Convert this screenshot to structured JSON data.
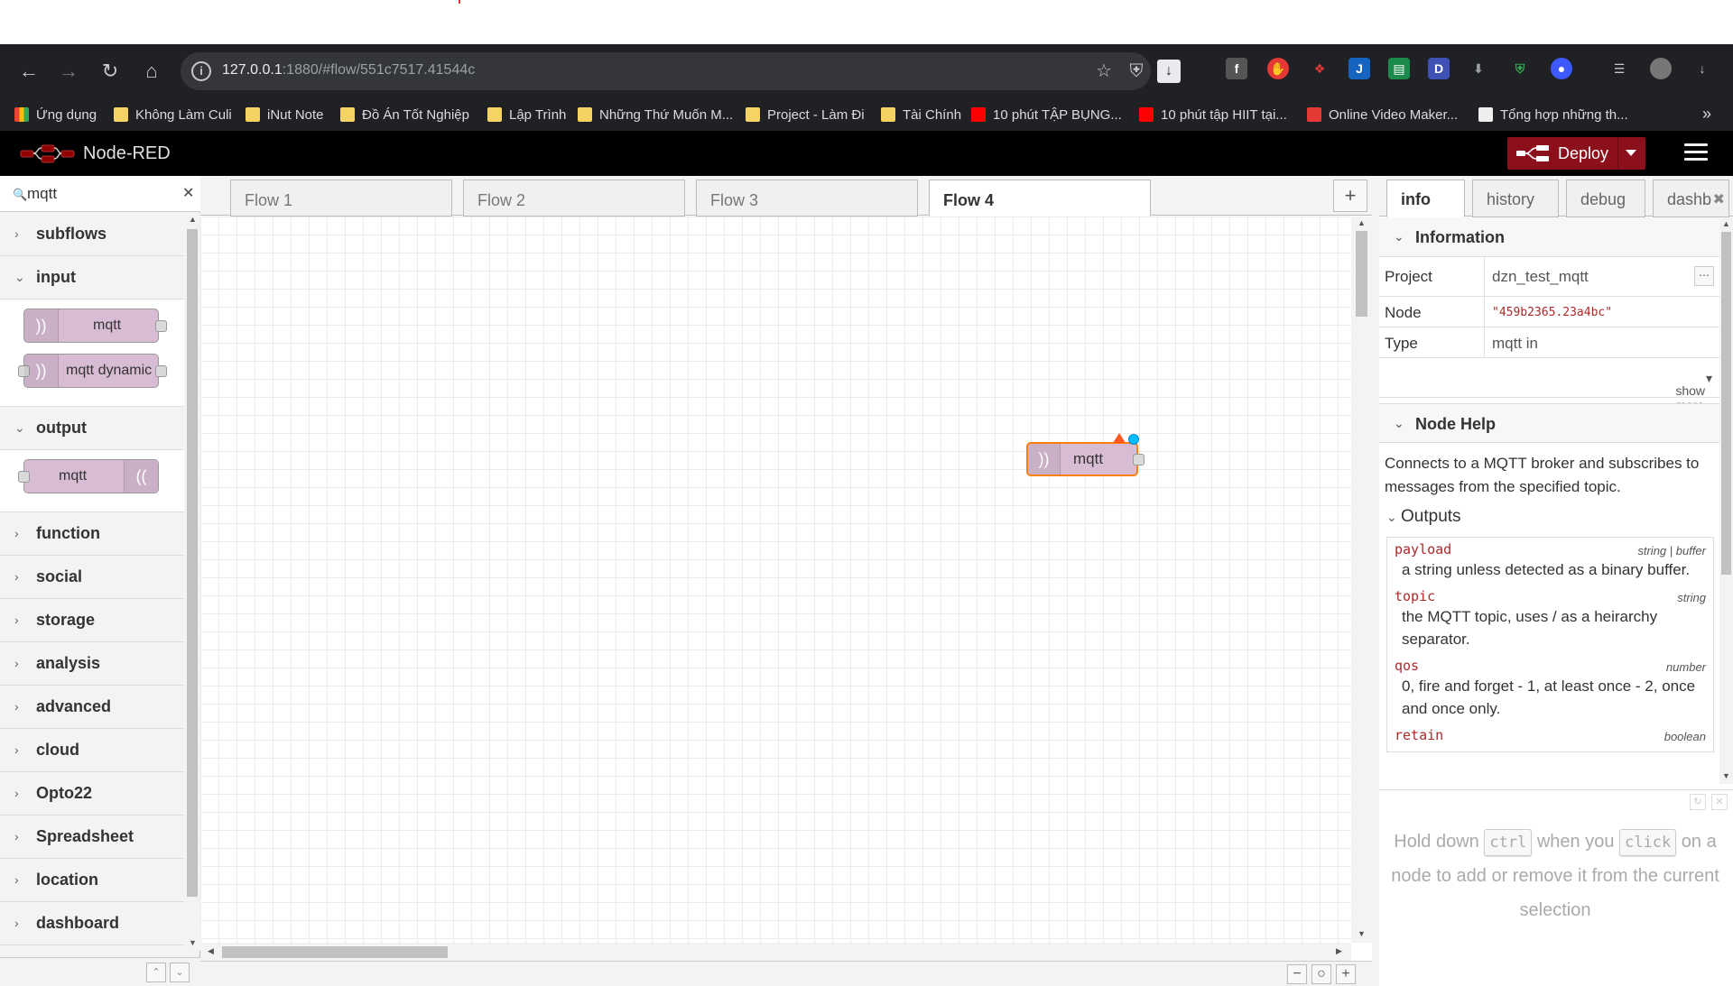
{
  "browser": {
    "url_host": "127.0.0.1",
    "url_rest": ":1880/#flow/551c7517.41544c",
    "bookmarks": [
      {
        "label": "Ứng dụng",
        "icon": "apps-icon"
      },
      {
        "label": "Không Làm Culi",
        "icon": "folder-icon"
      },
      {
        "label": "iNut Note",
        "icon": "folder-icon"
      },
      {
        "label": "Đồ Án Tốt Nghiệp",
        "icon": "folder-icon"
      },
      {
        "label": "Lập Trình",
        "icon": "folder-icon"
      },
      {
        "label": "Những Thứ Muốn M...",
        "icon": "folder-icon"
      },
      {
        "label": "Project - Làm Đi",
        "icon": "folder-icon"
      },
      {
        "label": "Tài Chính",
        "icon": "folder-icon"
      },
      {
        "label": "10 phút TẬP BỤNG...",
        "icon": "youtube-icon"
      },
      {
        "label": "10 phút tập HIIT tại...",
        "icon": "youtube-icon"
      },
      {
        "label": "Online Video Maker...",
        "icon": "gear-icon"
      },
      {
        "label": "Tổng hợp những th...",
        "icon": "ck-icon"
      }
    ],
    "more": "»"
  },
  "header": {
    "title": "Node-RED",
    "deploy_label": "Deploy"
  },
  "palette": {
    "search_value": "mqtt",
    "categories": {
      "subflows": "subflows",
      "input": "input",
      "output": "output",
      "function": "function",
      "social": "social",
      "storage": "storage",
      "analysis": "analysis",
      "advanced": "advanced",
      "cloud": "cloud",
      "opto22": "Opto22",
      "spreadsheet": "Spreadsheet",
      "location": "location",
      "dashboard": "dashboard"
    },
    "nodes": {
      "mqtt_in": "mqtt",
      "mqtt_dynamic": "mqtt dynamic",
      "mqtt_out": "mqtt"
    }
  },
  "workspace": {
    "tabs": [
      "Flow 1",
      "Flow 2",
      "Flow 3",
      "Flow 4"
    ],
    "active_tab": "Flow 4",
    "add_tab": "+",
    "node_label": "mqtt"
  },
  "sidebar": {
    "tabs": {
      "info": "info",
      "history": "history",
      "debug": "debug",
      "dashboard": "dashb"
    },
    "info": {
      "section_title": "Information",
      "project_key": "Project",
      "project_value": "dzn_test_mqtt",
      "node_key": "Node",
      "node_value": "\"459b2365.23a4bc\"",
      "type_key": "Type",
      "type_value": "mqtt in",
      "show_more": "show more"
    },
    "help": {
      "section_title": "Node Help",
      "description": "Connects to a MQTT broker and subscribes to messages from the specified topic.",
      "outputs_title": "Outputs",
      "outputs": [
        {
          "name": "payload",
          "type": "string | buffer",
          "desc": "a string unless detected as a binary buffer."
        },
        {
          "name": "topic",
          "type": "string",
          "desc": "the MQTT topic, uses / as a heirarchy separator."
        },
        {
          "name": "qos",
          "type": "number",
          "desc": "0, fire and forget - 1, at least once - 2, once and once only."
        },
        {
          "name": "retain",
          "type": "boolean",
          "desc": ""
        }
      ]
    },
    "tips": {
      "part1": "Hold down",
      "key1": "ctrl",
      "part2": "when you",
      "key2": "click",
      "part3": "on a node to add or remove it from the current selection"
    }
  }
}
